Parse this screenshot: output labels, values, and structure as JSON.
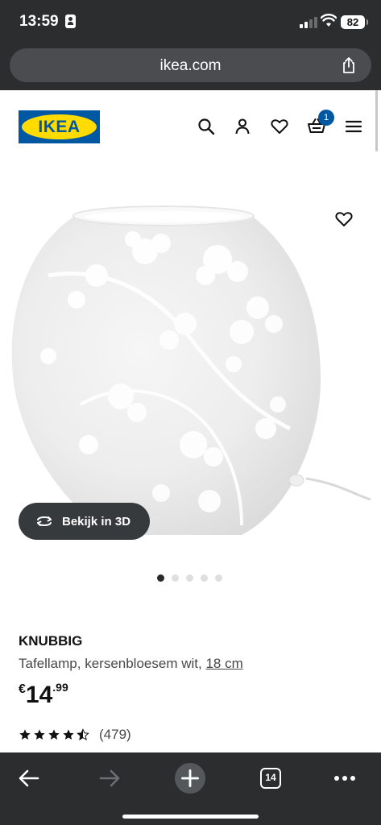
{
  "status_bar": {
    "time": "13:59",
    "battery": "82"
  },
  "browser": {
    "url": "ikea.com",
    "tabs_count": "14"
  },
  "header": {
    "logo_text": "IKEA",
    "cart_count": "1"
  },
  "gallery": {
    "view_3d_label": "Bekijk in 3D",
    "image_count": 5,
    "active_index": 0
  },
  "product": {
    "name": "KNUBBIG",
    "description": "Tafellamp, kersenbloesem wit, ",
    "size_link": "18 cm",
    "price_currency": "€",
    "price_integer": "14",
    "price_decimal": ".99",
    "rating": 4.5,
    "review_count": "(479)"
  },
  "colors": {
    "ikea_blue": "#0058a3",
    "ikea_yellow": "#ffdb00",
    "browser_chrome": "#2b2d2f"
  },
  "icons": [
    "search-icon",
    "user-icon",
    "heart-icon",
    "basket-icon",
    "menu-icon",
    "share-icon",
    "rotate-3d-icon",
    "back-icon",
    "forward-icon",
    "new-tab-icon",
    "more-icon"
  ]
}
